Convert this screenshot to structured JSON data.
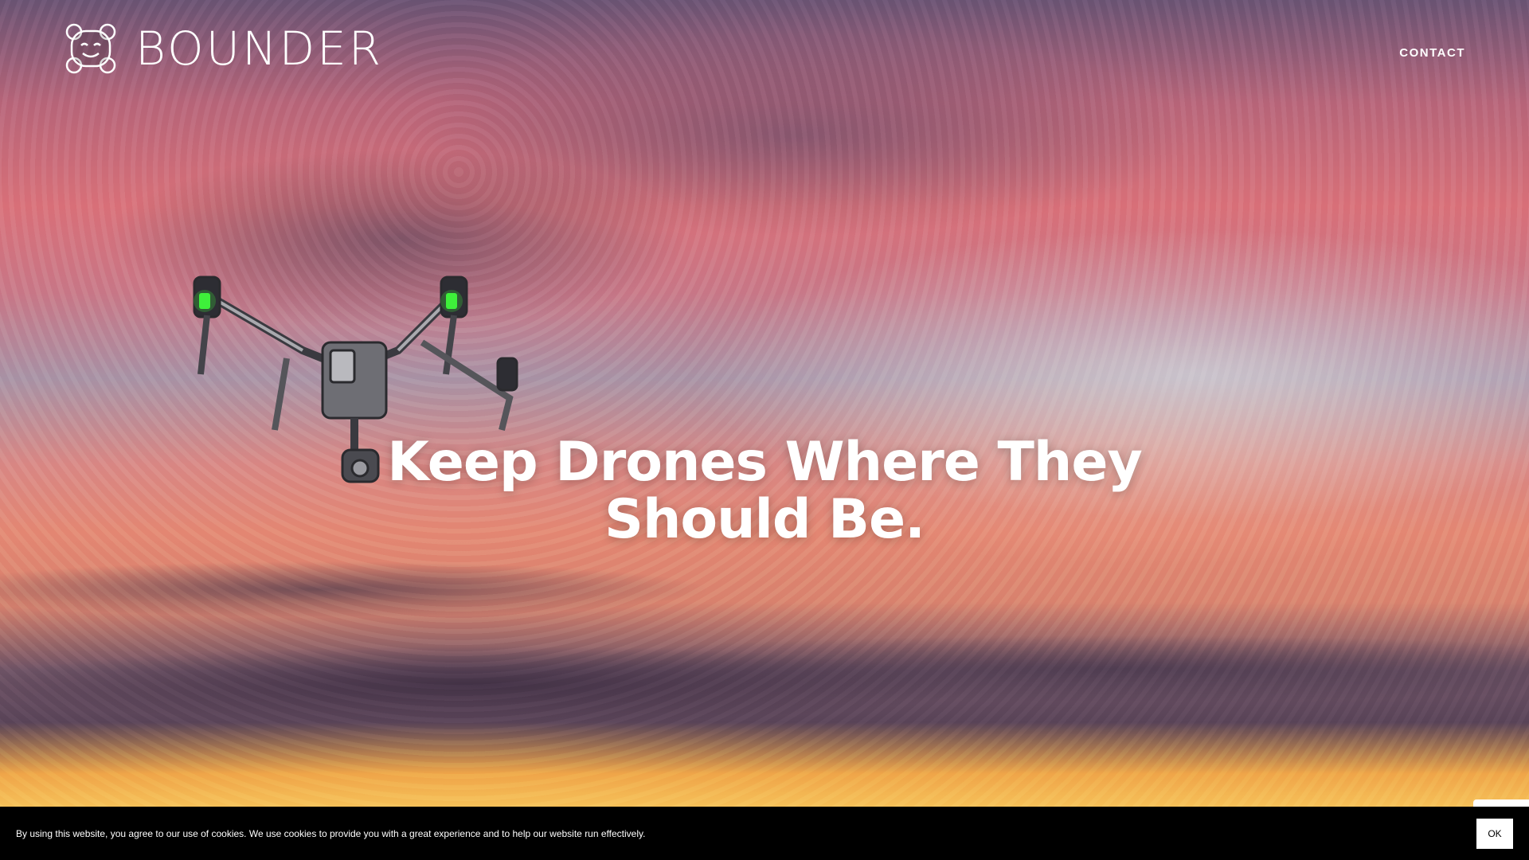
{
  "brand": {
    "name": "BOUNDER",
    "logo_icon": "robot-face-icon"
  },
  "nav": {
    "contact_label": "CONTACT"
  },
  "hero": {
    "headline_line1": "Keep Drones Where They",
    "headline_line2": "Should Be.",
    "image_icon": "drone-icon"
  },
  "cookie_banner": {
    "message": "By using this website, you agree to our use of cookies. We use cookies to provide you with a great experience and to help our website run effectively.",
    "ok_label": "OK"
  },
  "colors": {
    "text": "#ffffff",
    "banner_bg": "#000000",
    "drone_light": "#3ef03a"
  }
}
